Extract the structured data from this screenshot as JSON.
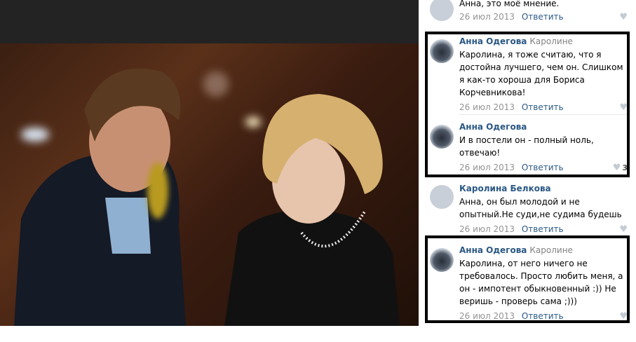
{
  "comments": [
    {
      "author": "",
      "reply_to": "",
      "text": "Анна, это моё мнение.",
      "date": "26 июл 2013",
      "reply_label": "Ответить",
      "likes": ""
    },
    {
      "author": "Анна Одегова",
      "reply_to": "Каролине",
      "text": "Каролина, я тоже считаю, что я достойна лучшего, чем он. Слишком я как-то хороша для Бориса Корчевникова!",
      "date": "26 июл 2013",
      "reply_label": "Ответить",
      "likes": ""
    },
    {
      "author": "Анна Одегова",
      "reply_to": "",
      "text": "И в постели он - полный ноль, отвечаю!",
      "date": "26 июл 2013",
      "reply_label": "Ответить",
      "likes": "3"
    },
    {
      "author": "Каролина Белкова",
      "reply_to": "",
      "text": "Анна, он был молодой и не опытный.Не суди,не судима будешь",
      "date": "26 июл 2013",
      "reply_label": "Ответить",
      "likes": ""
    },
    {
      "author": "Анна Одегова",
      "reply_to": "Каролине",
      "text": "Каролина, от него ничего не требовалось. Просто любить меня, а он - импотент обыкновенный :)) Не веришь - проверь сама ;)))",
      "date": "26 июл 2013",
      "reply_label": "Ответить",
      "likes": ""
    }
  ],
  "colors": {
    "author_link": "#2a5885",
    "meta_gray": "#939393",
    "highlight_border": "#000000"
  },
  "icons": {
    "like": "heart-icon"
  }
}
